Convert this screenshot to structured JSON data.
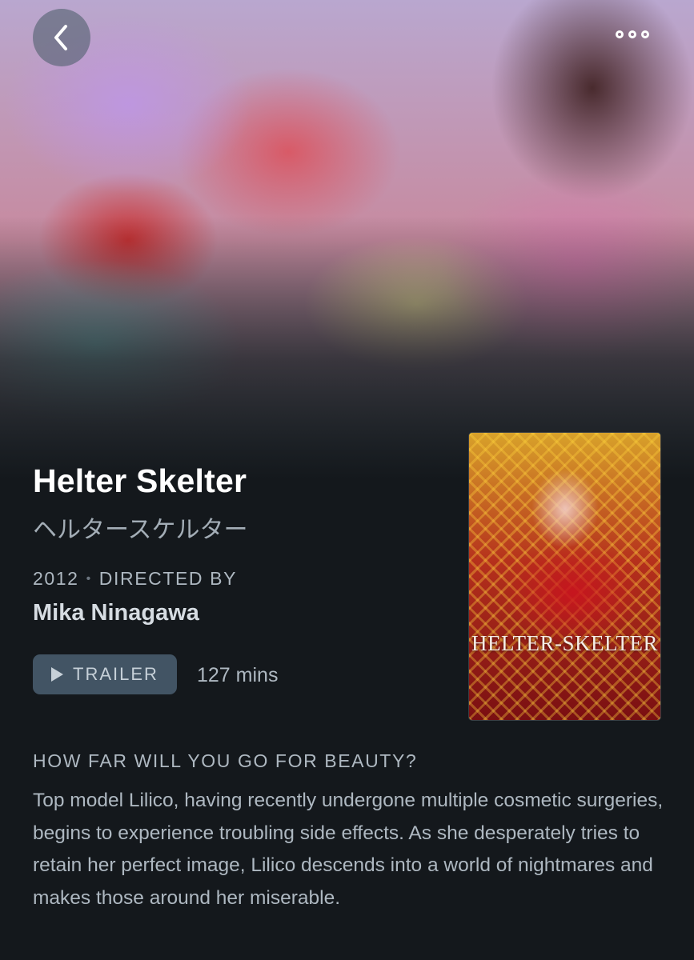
{
  "nav": {
    "back_icon": "chevron-left-icon",
    "more_icon": "more-options-icon"
  },
  "film": {
    "title": "Helter Skelter",
    "original_title": "ヘルタースケルター",
    "year": "2012",
    "directed_by_label": "DIRECTED BY",
    "director": "Mika Ninagawa",
    "trailer_label": "TRAILER",
    "runtime": "127 mins",
    "poster_title": "HELTER-SKELTER",
    "tagline": "HOW FAR WILL YOU GO FOR BEAUTY?",
    "synopsis": "Top model Lilico, having recently undergone multiple cosmetic surgeries, begins to experience troubling side effects. As she desperately tries to retain her perfect image, Lilico descends into a world of nightmares and makes those around her miserable."
  },
  "colors": {
    "background": "#14181c",
    "button": "#425464",
    "text_muted": "#aeb8c1"
  }
}
